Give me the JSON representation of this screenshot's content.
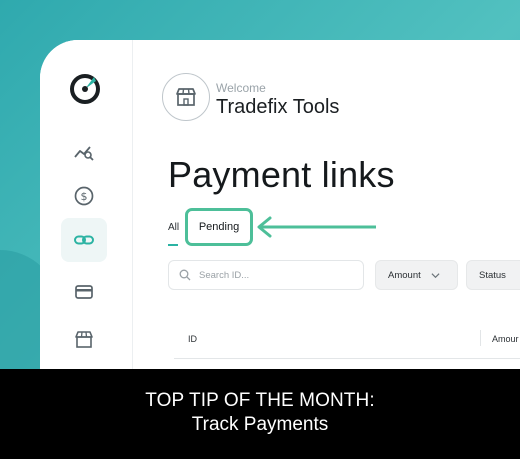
{
  "header": {
    "welcome": "Welcome",
    "store_name": "Tradefix Tools",
    "store_icon": "storefront-icon"
  },
  "sidebar": {
    "logo_icon": "gauge-logo-icon",
    "items": [
      {
        "icon": "analytics-icon",
        "active": false
      },
      {
        "icon": "dollar-icon",
        "active": false
      },
      {
        "icon": "link-icon",
        "active": true
      },
      {
        "icon": "card-icon",
        "active": false
      },
      {
        "icon": "store-icon",
        "active": false
      }
    ]
  },
  "page": {
    "title": "Payment links",
    "tabs": [
      {
        "label": "All",
        "active": true
      },
      {
        "label": "Pending",
        "highlighted": true
      }
    ]
  },
  "filters": {
    "search_placeholder": "Search ID...",
    "amount_label": "Amount",
    "status_label": "Status"
  },
  "table": {
    "columns": [
      "ID",
      "Amour"
    ]
  },
  "caption": {
    "line1": "TOP TIP OF THE MONTH:",
    "line2": "Track Payments"
  },
  "colors": {
    "background_teal": "#3fb2b3",
    "accent_green": "#4dbf99",
    "tab_underline": "#2bb3a3",
    "caption_bg": "#000000"
  }
}
